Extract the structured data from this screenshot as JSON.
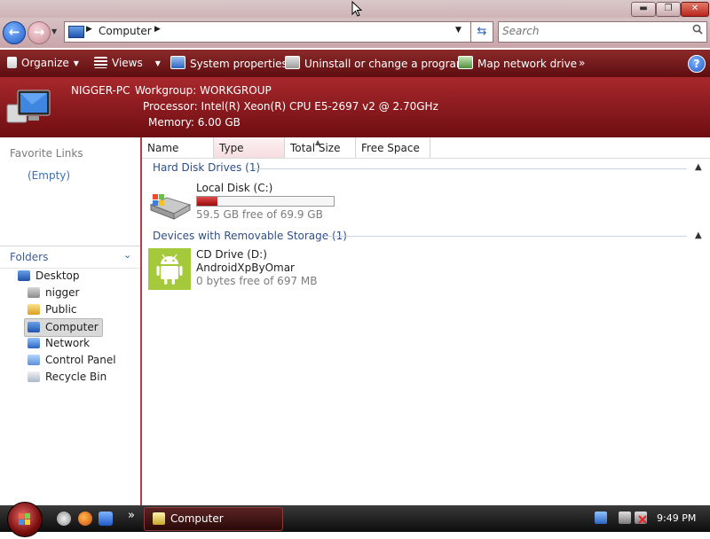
{
  "window": {
    "minimize": "▬",
    "maximize": "❐",
    "close": "✕"
  },
  "address": {
    "location": "Computer",
    "search_placeholder": "Search"
  },
  "toolbar": {
    "organize": "Organize",
    "views": "Views",
    "system_properties": "System properties",
    "uninstall": "Uninstall or change a program",
    "map_drive": "Map network drive",
    "overflow": "»",
    "help": "?"
  },
  "details": {
    "computer_name": "NIGGER-PC",
    "workgroup": "Workgroup: WORKGROUP",
    "processor": "Processor: Intel(R) Xeon(R) CPU E5-2697 v2 @ 2.70GHz",
    "memory": "Memory: 6.00 GB"
  },
  "nav": {
    "favorite_links_title": "Favorite Links",
    "favorite_links_empty": "(Empty)",
    "folders_title": "Folders",
    "tree": [
      "Desktop",
      "nigger",
      "Public",
      "Computer",
      "Network",
      "Control Panel",
      "Recycle Bin"
    ]
  },
  "columns": [
    "Name",
    "Type",
    "Total Size",
    "Free Space"
  ],
  "groups": {
    "hdd": {
      "title": "Hard Disk Drives (1)",
      "drive_name": "Local Disk (C:)",
      "free_text": "59.5 GB free of 69.9 GB",
      "used_fraction": 0.149
    },
    "removable": {
      "title": "Devices with Removable Storage (1)",
      "drive_name": "CD Drive (D:)",
      "volume_label": "AndroidXpByOmar",
      "free_text": "0 bytes free of 697 MB"
    }
  },
  "taskbar": {
    "window_label": "Computer",
    "clock": "9:49 PM",
    "overflow": "»"
  },
  "colors": {
    "accent": "#8c1f24",
    "toolbar": "#6e1114",
    "link": "#3c6fb6"
  }
}
